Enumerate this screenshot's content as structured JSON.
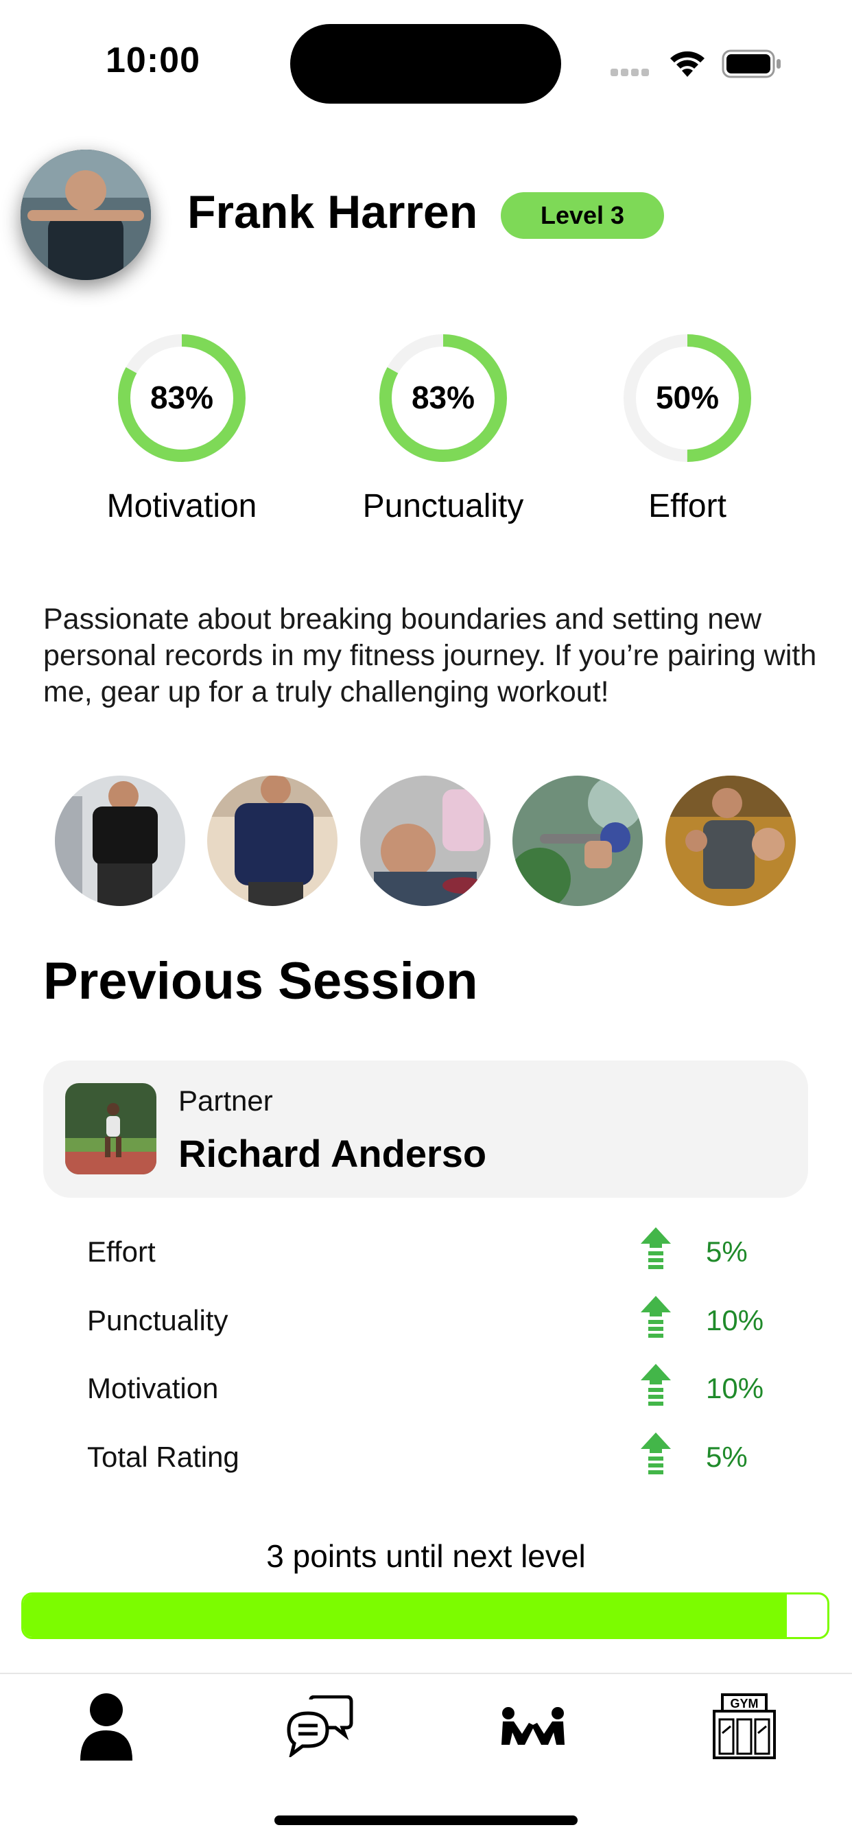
{
  "status_bar": {
    "time": "10:00"
  },
  "profile": {
    "name": "Frank Harren",
    "level_badge": "Level 3",
    "accent_color": "#7ed957",
    "bio": "Passionate about breaking boundaries and setting new personal records in my fitness journey. If you’re pairing with me, gear up for a truly challenging workout!"
  },
  "ratings": [
    {
      "label": "Motivation",
      "percent_text": "83%",
      "value": 0.83
    },
    {
      "label": "Punctuality",
      "percent_text": "83%",
      "value": 0.83
    },
    {
      "label": "Effort",
      "percent_text": "50%",
      "value": 0.5
    }
  ],
  "gallery": {
    "count": 5
  },
  "previous_session": {
    "title": "Previous Session",
    "partner_label": "Partner",
    "partner_name": "Richard Anderso",
    "stats": [
      {
        "label": "Effort",
        "change": "5%"
      },
      {
        "label": "Punctuality",
        "change": "10%"
      },
      {
        "label": "Motivation",
        "change": "10%"
      },
      {
        "label": "Total Rating",
        "change": "5%"
      }
    ],
    "positive_color": "#1f8a2a"
  },
  "progress": {
    "points_text": "3 points until next level",
    "fill_fraction": 0.95,
    "color": "#7cfc00"
  },
  "tab_bar": {
    "tabs": [
      {
        "name": "profile",
        "icon": "person-icon"
      },
      {
        "name": "chats",
        "icon": "chat-bubbles-icon"
      },
      {
        "name": "workout-partners",
        "icon": "workout-icon"
      },
      {
        "name": "gym",
        "icon": "gym-icon"
      }
    ]
  }
}
